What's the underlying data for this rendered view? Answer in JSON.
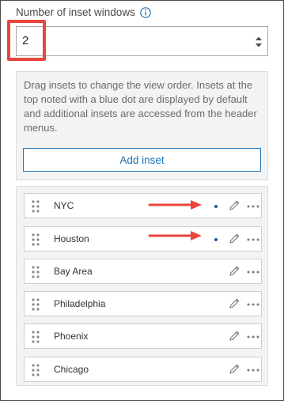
{
  "settings": {
    "count_label": "Number of inset windows",
    "count_value": "2",
    "info_text": "Drag insets to change the view order. Insets at the top noted with a blue dot are displayed by default and additional insets are accessed from the header menus.",
    "add_inset_label": "Add inset"
  },
  "insets": [
    {
      "label": "NYC",
      "default_visible": true
    },
    {
      "label": "Houston",
      "default_visible": true
    },
    {
      "label": "Bay Area",
      "default_visible": false
    },
    {
      "label": "Philadelphia",
      "default_visible": false
    },
    {
      "label": "Phoenix",
      "default_visible": false
    },
    {
      "label": "Chicago",
      "default_visible": false
    }
  ],
  "colors": {
    "accent_blue": "#1a73b8",
    "annotation_red": "#e8453c",
    "dot_blue": "#1a5b9e"
  },
  "icons": {
    "info": "info-icon",
    "select_arrows": "updown-arrows-icon",
    "drag": "drag-handle-icon",
    "edit": "pencil-icon",
    "more": "more-horizontal-icon"
  }
}
